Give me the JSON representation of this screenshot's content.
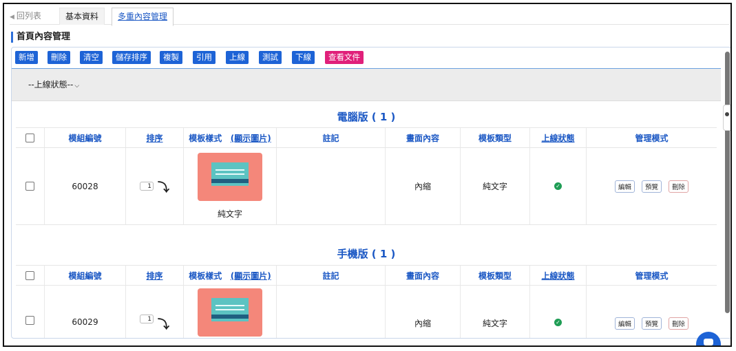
{
  "tabs": {
    "back": "回列表",
    "basic": "基本資料",
    "multi": "多重內容管理"
  },
  "section_title": "首頁內容管理",
  "toolbar": [
    {
      "label": "新增",
      "style": "blue"
    },
    {
      "label": "刪除",
      "style": "blue"
    },
    {
      "label": "清空",
      "style": "blue"
    },
    {
      "label": "儲存排序",
      "style": "blue"
    },
    {
      "label": "複製",
      "style": "blue"
    },
    {
      "label": "引用",
      "style": "blue"
    },
    {
      "label": "上線",
      "style": "blue"
    },
    {
      "label": "測試",
      "style": "blue"
    },
    {
      "label": "下線",
      "style": "blue"
    },
    {
      "label": "查看文件",
      "style": "pink"
    }
  ],
  "filter": {
    "status_select": "--上線狀態--"
  },
  "columns": {
    "module_id": "模組編號",
    "sort": "排序",
    "template": "模板樣式",
    "show_image": "(顯示圖片)",
    "note": "註記",
    "content": "畫面內容",
    "type": "模板類型",
    "status": "上線狀態",
    "manage": "管理模式"
  },
  "groups": [
    {
      "title": "電腦版 ( 1 )",
      "rows": [
        {
          "module_id": "60028",
          "sort": "1",
          "template_caption": "純文字",
          "note": "",
          "content": "內縮",
          "type": "純文字",
          "status": "online"
        }
      ]
    },
    {
      "title": "手機版 ( 1 )",
      "rows": [
        {
          "module_id": "60029",
          "sort": "1",
          "template_caption": "",
          "note": "",
          "content": "內縮",
          "type": "純文字",
          "status": "online"
        }
      ]
    }
  ],
  "manage_buttons": {
    "edit": "編輯",
    "preview": "預覽",
    "delete": "刪除"
  },
  "colors": {
    "accent": "#1d63d6",
    "pink": "#e0207a",
    "header_text": "#1a57c4",
    "online": "#1f9d55",
    "thumb_bg": "#f4877a"
  }
}
